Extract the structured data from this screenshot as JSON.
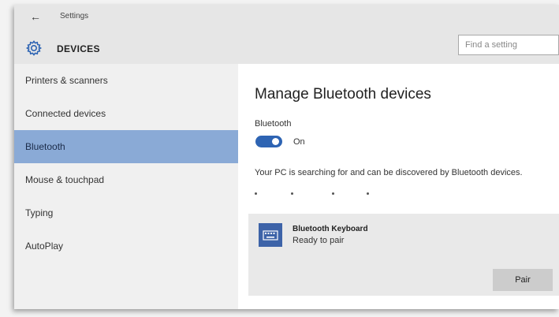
{
  "titlebar": {
    "title": "Settings",
    "back_icon": "back-arrow-icon"
  },
  "header": {
    "section_icon": "gear-icon",
    "section_title": "DEVICES"
  },
  "search": {
    "placeholder": "Find a setting"
  },
  "sidebar": {
    "items": [
      {
        "label": "Printers & scanners",
        "selected": false
      },
      {
        "label": "Connected devices",
        "selected": false
      },
      {
        "label": "Bluetooth",
        "selected": true
      },
      {
        "label": "Mouse & touchpad",
        "selected": false
      },
      {
        "label": "Typing",
        "selected": false
      },
      {
        "label": "AutoPlay",
        "selected": false
      }
    ]
  },
  "main": {
    "title": "Manage Bluetooth devices",
    "bluetooth_label": "Bluetooth",
    "toggle_state": "On",
    "searching_text": "Your PC is searching for and can be discovered by Bluetooth devices.",
    "device": {
      "icon": "keyboard-icon",
      "name": "Bluetooth Keyboard",
      "status": "Ready to pair",
      "action_label": "Pair"
    }
  },
  "colors": {
    "accent": "#2e64b3",
    "selected_nav": "#8aaad6",
    "device_icon": "#3d63a8",
    "card_bg": "#e9e9e9"
  }
}
